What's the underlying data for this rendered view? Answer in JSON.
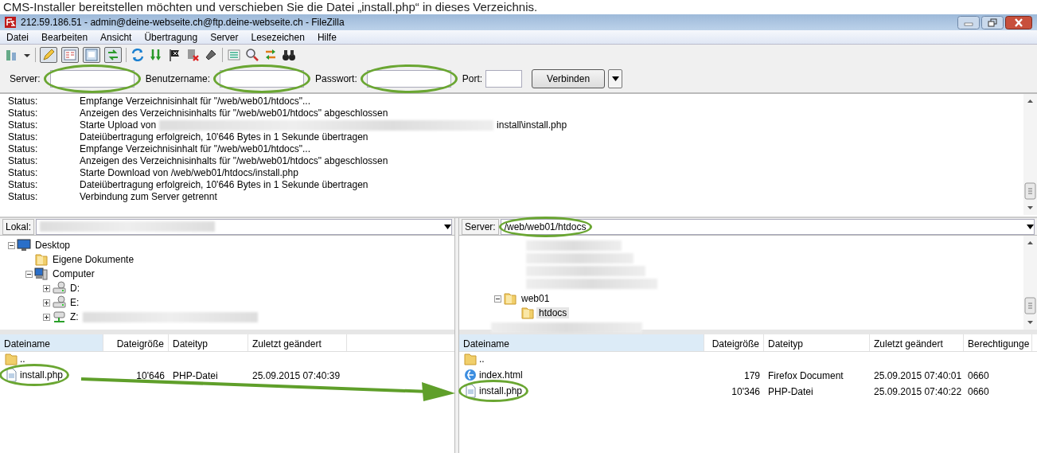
{
  "caption": "CMS-Installer bereitstellen möchten und verschieben Sie die Datei „install.php“ in dieses Verzeichnis.",
  "window": {
    "title": "212.59.186.51 - admin@deine-webseite.ch@ftp.deine-webseite.ch - FileZilla"
  },
  "menu": [
    "Datei",
    "Bearbeiten",
    "Ansicht",
    "Übertragung",
    "Server",
    "Lesezeichen",
    "Hilfe"
  ],
  "toolbar": {
    "toggles": [
      {
        "pressed": true
      },
      {
        "pressed": true
      },
      {
        "pressed": true
      },
      {
        "pressed": true
      }
    ]
  },
  "quickconnect": {
    "fields": [
      {
        "label": "Server:",
        "highlighted": true
      },
      {
        "label": "Benutzername:",
        "highlighted": true
      },
      {
        "label": "Passwort:",
        "highlighted": true
      },
      {
        "label": "Port:",
        "highlighted": false
      }
    ],
    "button": "Verbinden"
  },
  "log": [
    {
      "type": "Status:",
      "message": "Empfange Verzeichnisinhalt für \"/web/web01/htdocs\"..."
    },
    {
      "type": "Status:",
      "message": "Anzeigen des Verzeichnisinhalts für \"/web/web01/htdocs\" abgeschlossen"
    },
    {
      "type": "Status:",
      "message": "Starte Upload von",
      "tail": "install\\install.php"
    },
    {
      "type": "Status:",
      "message": "Dateiübertragung erfolgreich, 10'646 Bytes in 1 Sekunde übertragen"
    },
    {
      "type": "Status:",
      "message": "Empfange Verzeichnisinhalt für \"/web/web01/htdocs\"..."
    },
    {
      "type": "Status:",
      "message": "Anzeigen des Verzeichnisinhalts für \"/web/web01/htdocs\" abgeschlossen"
    },
    {
      "type": "Status:",
      "message": "Starte Download von /web/web01/htdocs/install.php"
    },
    {
      "type": "Status:",
      "message": "Dateiübertragung erfolgreich, 10'646 Bytes in 1 Sekunde übertragen"
    },
    {
      "type": "Status:",
      "message": "Verbindung zum Server getrennt"
    }
  ],
  "local": {
    "path_label": "Lokal:",
    "tree": [
      {
        "label": "Desktop",
        "kind": "desktop",
        "expanded": true,
        "selected": false,
        "children": [
          {
            "label": "Eigene Dokumente",
            "kind": "folder",
            "selected": false
          },
          {
            "label": "Computer",
            "kind": "computer",
            "expanded": true,
            "selected": false,
            "children": [
              {
                "label": "D:",
                "kind": "drive",
                "expanded": false,
                "selected": false
              },
              {
                "label": "E:",
                "kind": "drive",
                "expanded": false,
                "selected": false
              },
              {
                "label": "Z:",
                "kind": "network",
                "expanded": false,
                "selected": false
              }
            ]
          }
        ]
      }
    ],
    "columns": [
      "Dateiname",
      "Dateigröße",
      "Dateityp",
      "Zuletzt geändert"
    ],
    "files": [
      {
        "name": "..",
        "kind": "parent",
        "highlighted": false
      },
      {
        "name": "install.php",
        "kind": "file",
        "size": "10'646",
        "type": "PHP-Datei",
        "modified": "25.09.2015 07:40:39",
        "highlighted": true
      }
    ]
  },
  "remote": {
    "path_label": "Server:",
    "path": "/web/web01/htdocs",
    "path_highlighted": true,
    "tree": [
      {
        "label": "web01",
        "kind": "folder",
        "expanded": true,
        "selected": false,
        "children": [
          {
            "label": "htdocs",
            "kind": "folder",
            "selected": true
          }
        ]
      }
    ],
    "columns": [
      "Dateiname",
      "Dateigröße",
      "Dateityp",
      "Zuletzt geändert",
      "Berechtigunge"
    ],
    "files": [
      {
        "name": "..",
        "kind": "parent",
        "highlighted": false
      },
      {
        "name": "index.html",
        "kind": "html",
        "size": "179",
        "type": "Firefox Document",
        "modified": "25.09.2015 07:40:01",
        "permissions": "0660",
        "highlighted": false
      },
      {
        "name": "install.php",
        "kind": "file",
        "size": "10'346",
        "type": "PHP-Datei",
        "modified": "25.09.2015 07:40:22",
        "permissions": "0660",
        "highlighted": true
      }
    ]
  }
}
